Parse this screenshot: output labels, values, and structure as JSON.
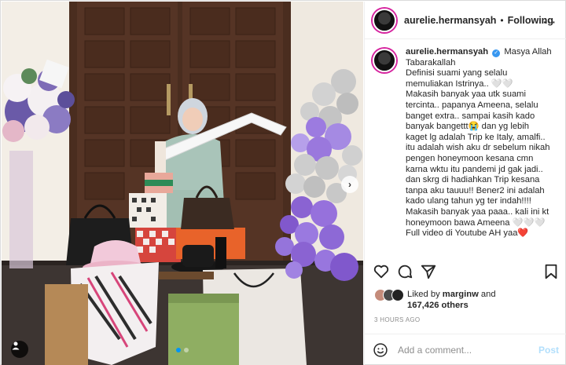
{
  "header": {
    "username": "aurelie.hermansyah",
    "separator": "•",
    "follow_label": "Following",
    "more_icon": "more-options-icon"
  },
  "caption": {
    "username": "aurelie.hermansyah",
    "verified_icon": "verified-badge-icon",
    "text": "Masya Allah\nTabarakallah\nDefinisi suami yang selalu\nmemuliakan Istrinya.. 🤍🤍\nMakasih banyak yaa utk suami\ntercinta.. papanya Ameena, selalu\nbanget extra.. sampai kasih kado\nbanyak bangettt😭 dan yg lebih\nkaget lg adalah Trip ke Italy, amalfi..\nitu adalah wish aku dr sebelum nikah\npengen honeymoon kesana cmn\nkarna wktu itu pandemi jd gak jadi..\ndan skrg di hadiahkan Trip kesana\ntanpa aku tauuu!! Bener2 ini adalah\nkado ulang tahun yg ter indah!!!!\nMakasih banyak yaa paaa.. kali ini kt\nhoneymoon bawa Ameena 🤍🤍🤍\nFull video di Youtube AH yaa❤️"
  },
  "actions": {
    "like_icon": "heart-icon",
    "comment_icon": "comment-icon",
    "share_icon": "share-icon",
    "save_icon": "bookmark-icon"
  },
  "likes": {
    "prefix": "Liked by ",
    "user": "marginw",
    "and": " and",
    "count": "167,426 others"
  },
  "timestamp": "3 HOURS AGO",
  "comment": {
    "placeholder": "Add a comment...",
    "post_label": "Post",
    "emoji_icon": "emoji-icon"
  },
  "photo": {
    "carousel_total": 2,
    "carousel_active": 1,
    "next_icon": "chevron-right-icon",
    "tag_icon": "user-tag-icon"
  },
  "colors": {
    "accent": "#0095f6",
    "post_disabled": "#b2dffc",
    "verified": "#3897f0",
    "balloon_purple": "#8a63d2",
    "balloon_grey": "#c9c9c9"
  }
}
